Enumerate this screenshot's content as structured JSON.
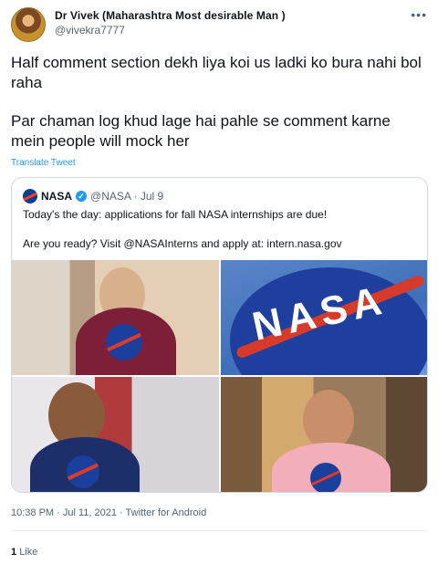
{
  "author": {
    "display_name": "Dr Vivek (Maharashtra Most desirable Man )",
    "handle": "@vivekra7777"
  },
  "tweet": {
    "paragraphs": [
      "Half comment section dekh liya koi us ladki ko bura nahi bol raha",
      "Par chaman log khud lage hai pahle se comment karne mein people will mock her"
    ],
    "translate_label": "Translate Tweet"
  },
  "quote": {
    "name": "NASA",
    "verified_glyph": "✓",
    "handle_date": "@NASA · Jul 9",
    "paragraphs": [
      "Today's the day: applications for fall NASA internships are due!",
      "Are you ready? Visit @NASAInterns and apply at: intern.nasa.gov"
    ],
    "photo_text": "NASA"
  },
  "meta": {
    "timestamp": "10:38 PM · Jul 11, 2021 · Twitter for Android"
  },
  "engagement": {
    "like_count": "1",
    "like_label": "Like"
  },
  "colors": {
    "accent": "#1d9bf0",
    "text": "#0f1419",
    "secondary": "#536471",
    "border": "#cfd9de"
  }
}
